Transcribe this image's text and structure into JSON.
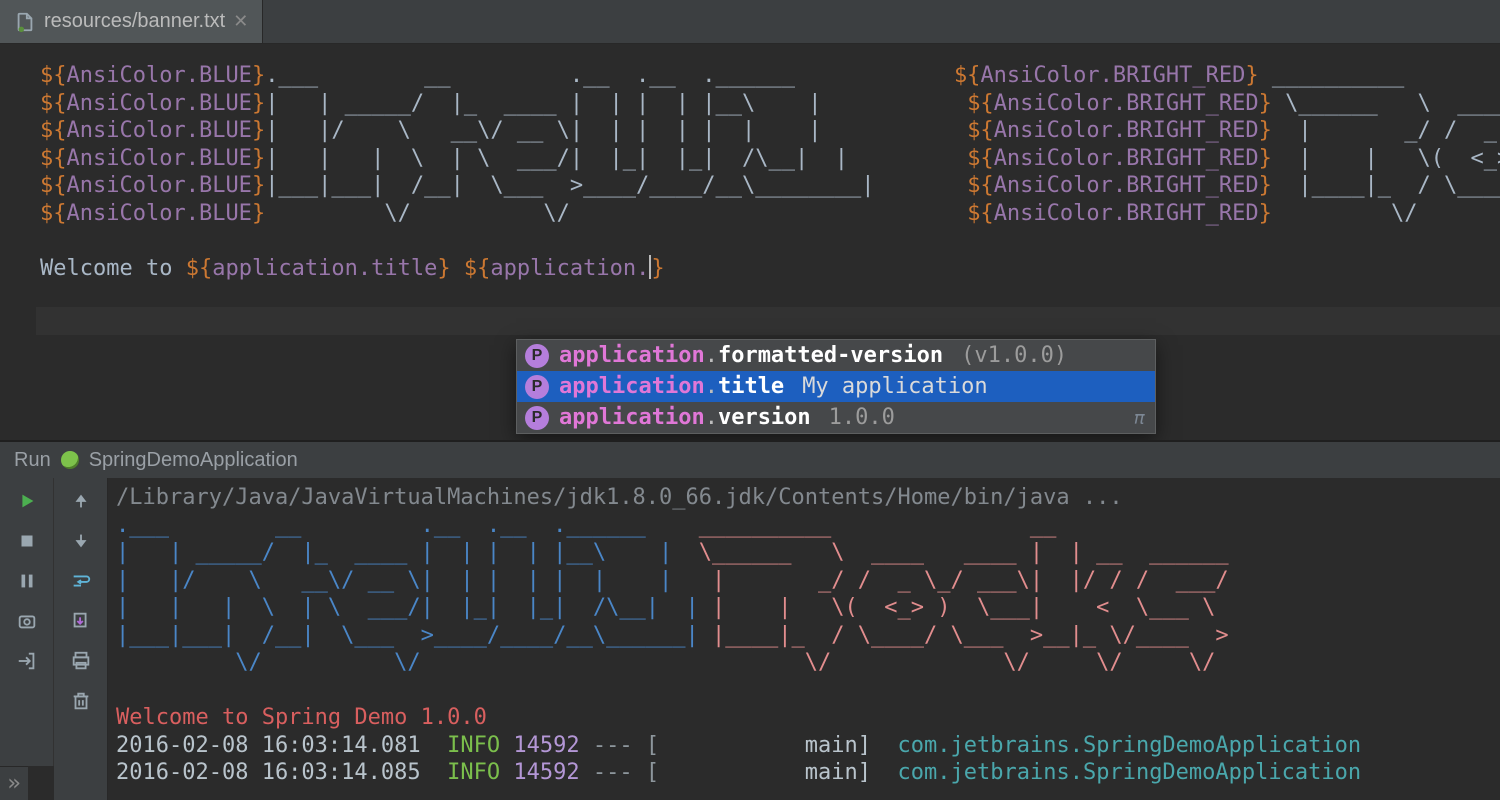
{
  "tab": {
    "filename": "resources/banner.txt"
  },
  "editor": {
    "color_left_token": "AnsiColor.BLUE",
    "color_right_token": "AnsiColor.BRIGHT_RED",
    "ascii_lines": [
      {
        "l": ".___        __         .__  .__  .______            ",
        "r": " __________               "
      },
      {
        "l": "|   | _____/  |_  ____ |  | |  | |__\\    |           ",
        "r": " \\______   \\  ____   ____ "
      },
      {
        "l": "|   |/    \\   __\\/ __ \\|  | |  | |  |    |           ",
        "r": "  |       _/ /  _ \\_/ ___\\"
      },
      {
        "l": "|   |   |  \\  | \\  ___/|  |_|  |_|  /\\__|  |         ",
        "r": "  |    |   \\(  <_> )  \\___"
      },
      {
        "l": "|___|___|  /__|  \\___  >____/____/__\\________|       ",
        "r": "  |____|_  / \\____/ \\___  "
      },
      {
        "l": "         \\/          \\/                              ",
        "r": "         \\/             \\/"
      }
    ],
    "welcome_prefix": "Welcome to ",
    "welcome_var1": "application.title",
    "welcome_partial": "application."
  },
  "completion": {
    "items": [
      {
        "key_app": "application",
        "key_field": "formatted-version",
        "value": "(v1.0.0)",
        "selected": false
      },
      {
        "key_app": "application",
        "key_field": "title",
        "value": "My application",
        "selected": true
      },
      {
        "key_app": "application",
        "key_field": "version",
        "value": "1.0.0",
        "selected": false
      }
    ],
    "badge_letter": "P",
    "pi": "π"
  },
  "run": {
    "label": "Run",
    "config_name": "SpringDemoApplication",
    "cmd": "/Library/Java/JavaVirtualMachines/jdk1.8.0_66.jdk/Contents/Home/bin/java ...",
    "ascii_intellij": [
      ".___        __         .__  .__  .______    ",
      "|   | _____/  |_  ____ |  | |  | |__\\    |  ",
      "|   |/    \\   __\\/ __ \\|  | |  | |  |    |  ",
      "|   |   |  \\  | \\  ___/|  |_|  |_|  /\\__|  |",
      "|___|___|  /__|  \\___  >____/____/__\\______|",
      "         \\/          \\/                     "
    ],
    "ascii_rocks": [
      "__________               __            ",
      "\\______   \\  ____   ____ |  | __  ______",
      " |       _/ /  _ \\_/ ___\\|  |/ / /  ___/",
      " |    |   \\(  <_> )  \\___|    <  \\___ \\ ",
      " |____|_  / \\____/ \\___  >__|_ \\/____  >",
      "        \\/             \\/     \\/     \\/ "
    ],
    "welcome_line": "Welcome to Spring Demo 1.0.0",
    "log": [
      {
        "ts": "2016-02-08 16:03:14.081",
        "level": "INFO",
        "pid": "14592",
        "sep": "--- [",
        "thread": "main]",
        "cls": "com.jetbrains.SpringDemoApplication"
      },
      {
        "ts": "2016-02-08 16:03:14.085",
        "level": "INFO",
        "pid": "14592",
        "sep": "--- [",
        "thread": "main]",
        "cls": "com.jetbrains.SpringDemoApplication"
      }
    ]
  }
}
